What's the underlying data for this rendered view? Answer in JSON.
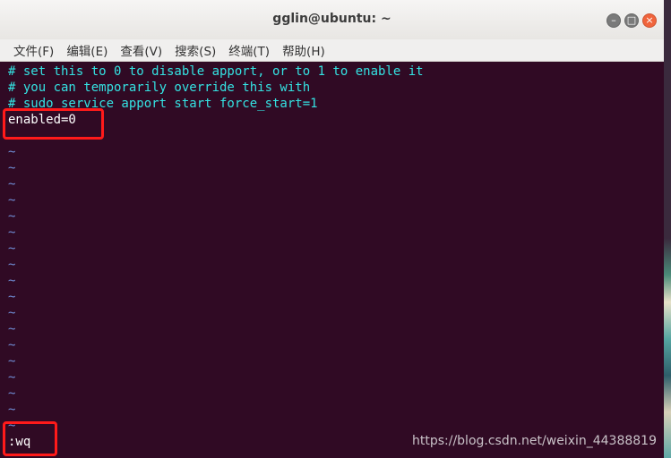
{
  "window": {
    "title": "gglin@ubuntu: ~",
    "buttons": {
      "minimize": "–",
      "maximize": "□",
      "close": "×"
    }
  },
  "menubar": {
    "items": [
      "文件(F)",
      "编辑(E)",
      "查看(V)",
      "搜索(S)",
      "终端(T)",
      "帮助(H)"
    ]
  },
  "terminal": {
    "lines": [
      "# set this to 0 to disable apport, or to 1 to enable it",
      "# you can temporarily override this with",
      "# sudo service apport start force_start=1",
      "enabled=0"
    ],
    "tilde": "~",
    "command": ":wq"
  },
  "watermark": "https://blog.csdn.net/weixin_44388819",
  "colors": {
    "terminal_bg": "#300a24",
    "comment": "#34e2e2",
    "tilde": "#6f8dd5",
    "highlight": "#ff1a1a"
  }
}
